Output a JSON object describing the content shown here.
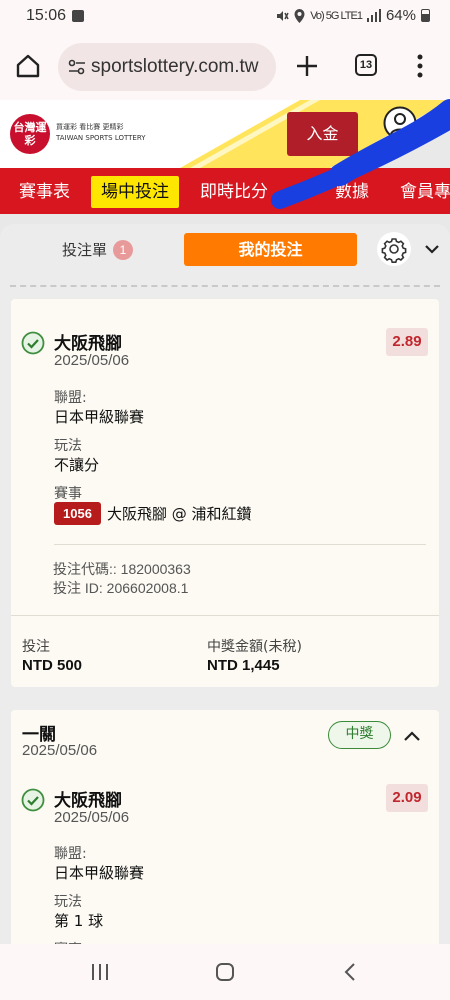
{
  "status_bar": {
    "time": "15:06",
    "network": "Vo) 5G LTE1",
    "battery": "64%"
  },
  "browser": {
    "url": "sportslottery.com.tw",
    "tab_count": "13"
  },
  "site": {
    "logo_text": "台灣運彩",
    "logo_tagline": "買運彩 看比賽 更精彩",
    "logo_english": "TAIWAN SPORTS LOTTERY",
    "deposit_label": "入金"
  },
  "nav": {
    "tabs": [
      "賽事表",
      "場中投注",
      "即時比分",
      "數據",
      "會員專"
    ]
  },
  "betpanel": {
    "betslip_label": "投注單",
    "betslip_count": "1",
    "mybets_label": "我的投注"
  },
  "bet1": {
    "team": "大阪飛腳",
    "date": "2025/05/06",
    "odds": "2.89",
    "league_label": "聯盟:",
    "league": "日本甲級聯賽",
    "market_label": "玩法",
    "market": "不讓分",
    "event_label": "賽事",
    "match_no": "1056",
    "match": "大阪飛腳 @ 浦和紅鑽",
    "code": "投注代碼:: 182000363",
    "bet_id": "投注 ID: 206602008.1",
    "stake_label": "投注",
    "stake": "NTD 500",
    "payout_label": "中獎金額(未稅)",
    "payout": "NTD 1,445"
  },
  "bet2": {
    "title": "一關",
    "date": "2025/05/06",
    "status": "中獎",
    "team": "大阪飛腳",
    "team_date": "2025/05/06",
    "odds": "2.09",
    "league_label": "聯盟:",
    "league": "日本甲級聯賽",
    "market_label": "玩法",
    "market": "第 1 球",
    "event_label": "賽事"
  }
}
